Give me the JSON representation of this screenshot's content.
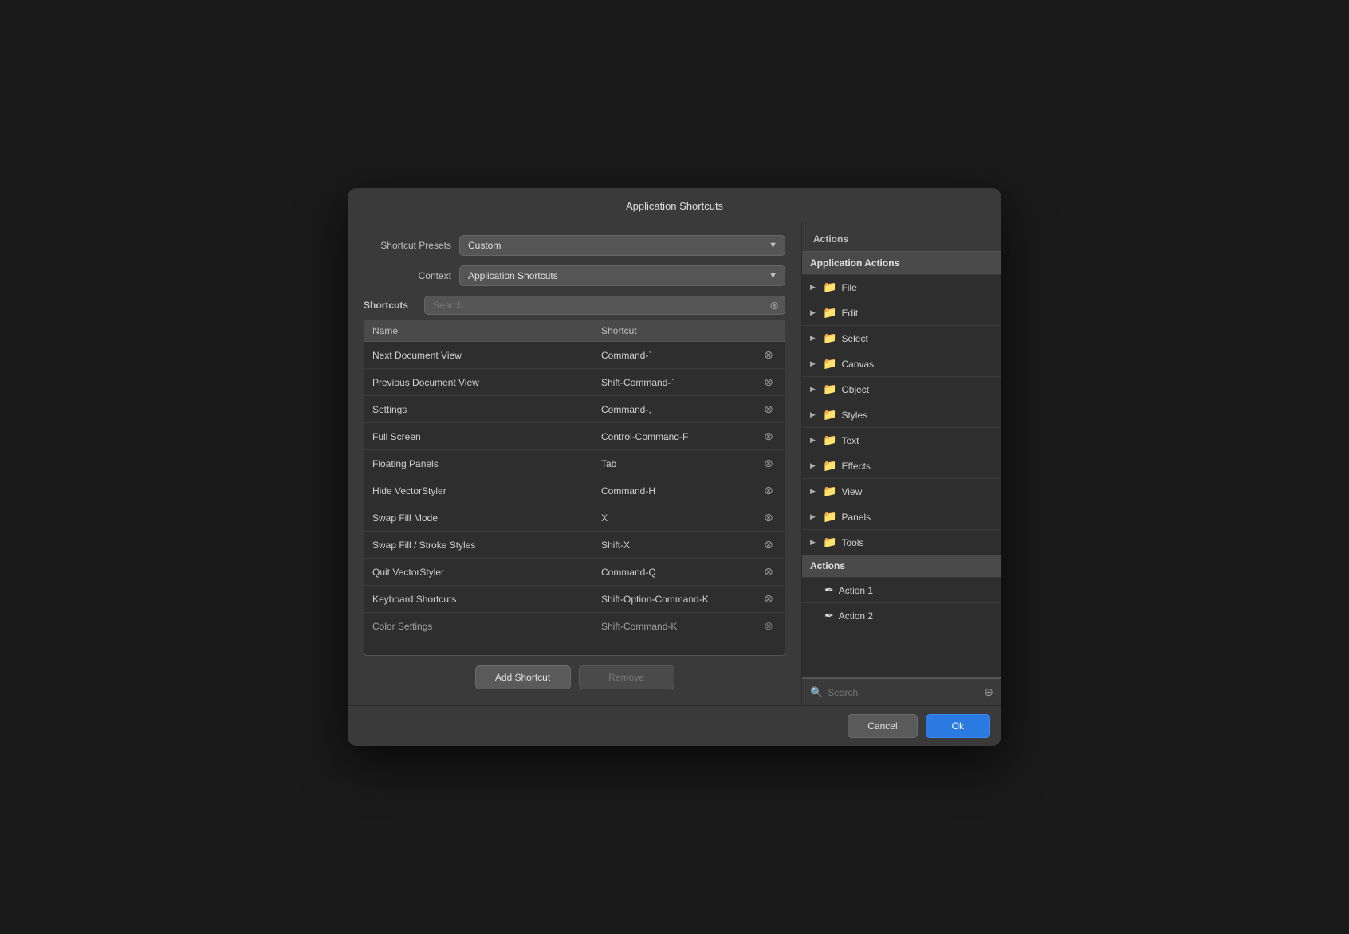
{
  "dialog": {
    "title": "Application Shortcuts"
  },
  "left": {
    "presets_label": "Shortcut Presets",
    "presets_value": "Custom",
    "context_label": "Context",
    "context_value": "Application Shortcuts",
    "shortcuts_label": "Shortcuts",
    "search_placeholder": "Search",
    "table": {
      "col_name": "Name",
      "col_shortcut": "Shortcut",
      "rows": [
        {
          "name": "Next Document View",
          "shortcut": "Command-`"
        },
        {
          "name": "Previous Document View",
          "shortcut": "Shift-Command-`"
        },
        {
          "name": "Settings",
          "shortcut": "Command-,"
        },
        {
          "name": "Full Screen",
          "shortcut": "Control-Command-F"
        },
        {
          "name": "Floating Panels",
          "shortcut": "Tab"
        },
        {
          "name": "Hide VectorStyler",
          "shortcut": "Command-H"
        },
        {
          "name": "Swap Fill Mode",
          "shortcut": "X"
        },
        {
          "name": "Swap Fill / Stroke Styles",
          "shortcut": "Shift-X"
        },
        {
          "name": "Quit VectorStyler",
          "shortcut": "Command-Q"
        },
        {
          "name": "Keyboard Shortcuts",
          "shortcut": "Shift-Option-Command-K"
        },
        {
          "name": "Color Settings",
          "shortcut": "Shift-Command-K"
        }
      ]
    },
    "btn_add": "Add Shortcut",
    "btn_remove": "Remove"
  },
  "right": {
    "actions_label": "Actions",
    "tree": {
      "header": "Application Actions",
      "items": [
        {
          "label": "File",
          "type": "folder"
        },
        {
          "label": "Edit",
          "type": "folder"
        },
        {
          "label": "Select",
          "type": "folder"
        },
        {
          "label": "Canvas",
          "type": "folder"
        },
        {
          "label": "Object",
          "type": "folder"
        },
        {
          "label": "Styles",
          "type": "folder"
        },
        {
          "label": "Text",
          "type": "folder"
        },
        {
          "label": "Effects",
          "type": "folder"
        },
        {
          "label": "View",
          "type": "folder"
        },
        {
          "label": "Panels",
          "type": "folder"
        },
        {
          "label": "Tools",
          "type": "folder"
        }
      ],
      "section_actions": "Actions",
      "action_items": [
        {
          "label": "Action 1"
        },
        {
          "label": "Action 2"
        }
      ]
    },
    "search_placeholder": "Search",
    "btn_cancel": "Cancel",
    "btn_ok": "Ok"
  }
}
